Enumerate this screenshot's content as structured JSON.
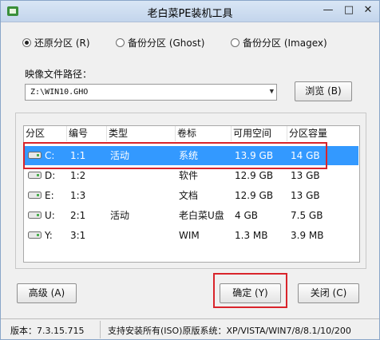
{
  "window": {
    "title": "老白菜PE装机工具",
    "min_glyph": "—",
    "max_glyph": "□",
    "close_glyph": "✕"
  },
  "options": {
    "restore": "还原分区 (R)",
    "backup_ghost": "备份分区 (Ghost)",
    "backup_imagex": "备份分区 (Imagex)",
    "selected": "restore"
  },
  "image_path": {
    "label": "映像文件路径：",
    "value": "Z:\\WIN10.GHO",
    "dropdown_glyph": "▼",
    "browse_button": "浏览 (B)"
  },
  "table": {
    "headers": [
      "分区",
      "编号",
      "类型",
      "卷标",
      "可用空间",
      "分区容量"
    ],
    "rows": [
      {
        "drive": "C:",
        "number": "1:1",
        "type": "活动",
        "label": "系统",
        "free": "13.9 GB",
        "size": "14 GB",
        "selected": true
      },
      {
        "drive": "D:",
        "number": "1:2",
        "type": "",
        "label": "软件",
        "free": "12.9 GB",
        "size": "13 GB",
        "selected": false
      },
      {
        "drive": "E:",
        "number": "1:3",
        "type": "",
        "label": "文档",
        "free": "12.9 GB",
        "size": "13 GB",
        "selected": false
      },
      {
        "drive": "U:",
        "number": "2:1",
        "type": "活动",
        "label": "老白菜U盘",
        "free": "4 GB",
        "size": "7.5 GB",
        "selected": false
      },
      {
        "drive": "Y:",
        "number": "3:1",
        "type": "",
        "label": "WIM",
        "free": "1.3 MB",
        "size": "3.9 MB",
        "selected": false
      }
    ]
  },
  "buttons": {
    "advanced": "高级 (A)",
    "ok": "确定 (Y)",
    "close": "关闭 (C)"
  },
  "status": {
    "version": "版本：7.3.15.715",
    "support": "支持安装所有(ISO)原版系统：XP/VISTA/WIN7/8/8.1/10/200"
  },
  "colors": {
    "selection": "#3399ff",
    "highlight_box": "#d9242b"
  }
}
